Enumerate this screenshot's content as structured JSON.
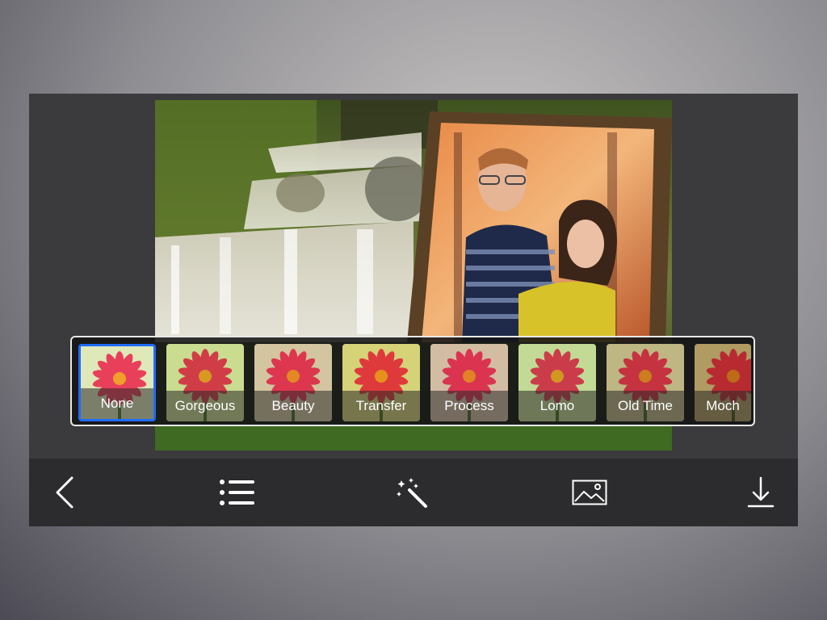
{
  "filters": [
    {
      "label": "None",
      "selected": true,
      "tint": "#ffffff"
    },
    {
      "label": "Gorgeous",
      "selected": false,
      "tint": "#e6f2c8"
    },
    {
      "label": "Beauty",
      "selected": false,
      "tint": "#f2d9dc"
    },
    {
      "label": "Transfer",
      "selected": false,
      "tint": "#f5e7a6"
    },
    {
      "label": "Process",
      "selected": false,
      "tint": "#f0d0e2"
    },
    {
      "label": "Lomo",
      "selected": false,
      "tint": "#dff0d0"
    },
    {
      "label": "Old Time",
      "selected": false,
      "tint": "#d9c8b6"
    },
    {
      "label": "Moch",
      "selected": false,
      "tint": "#c9ab88"
    }
  ],
  "toolbar": {
    "back_icon": "chevron-left-icon",
    "list_icon": "list-icon",
    "effects_icon": "magic-wand-icon",
    "image_icon": "image-icon",
    "download_icon": "download-icon"
  },
  "colors": {
    "selected_border": "#1e6cff",
    "toolbar_bg": "#2c2c2e",
    "panel_bg": "#3b3b3d"
  }
}
